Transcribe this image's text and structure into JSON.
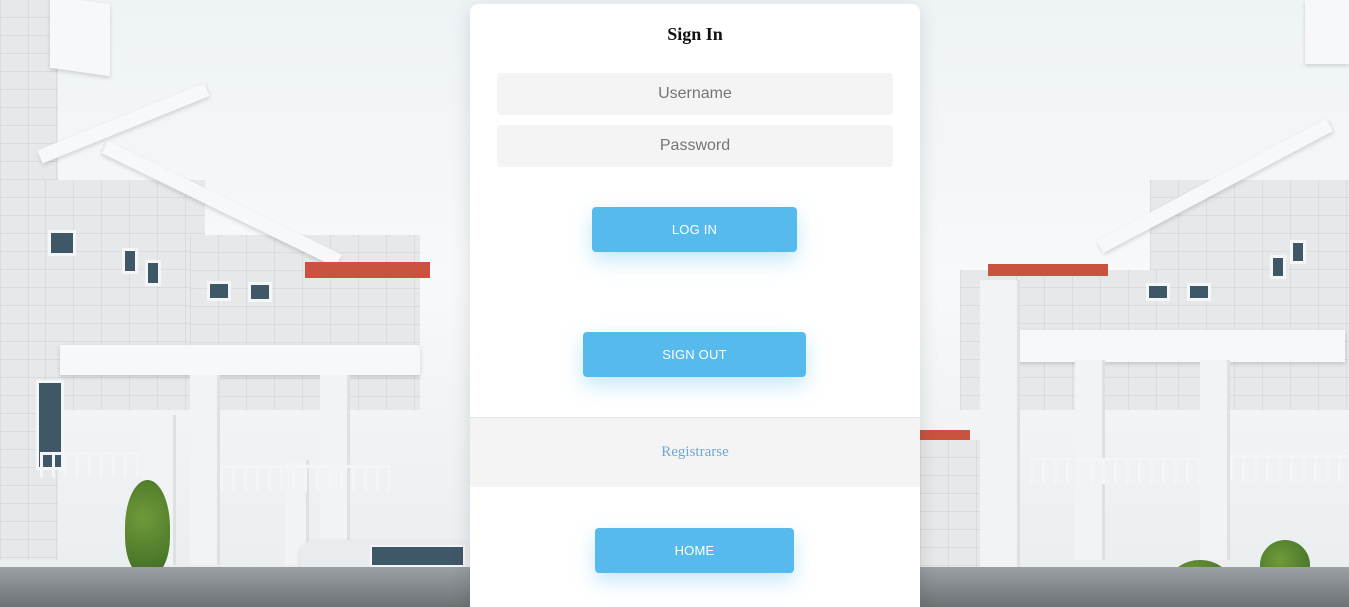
{
  "signin": {
    "title": "Sign In",
    "username_placeholder": "Username",
    "password_placeholder": "Password",
    "login_label": "LOG IN",
    "signout_label": "SIGN OUT",
    "register_label": "Registrarse",
    "home_label": "HOME"
  },
  "colors": {
    "button": "#56bbec",
    "field_bg": "#f4f4f4",
    "link": "#6fa8cf"
  }
}
